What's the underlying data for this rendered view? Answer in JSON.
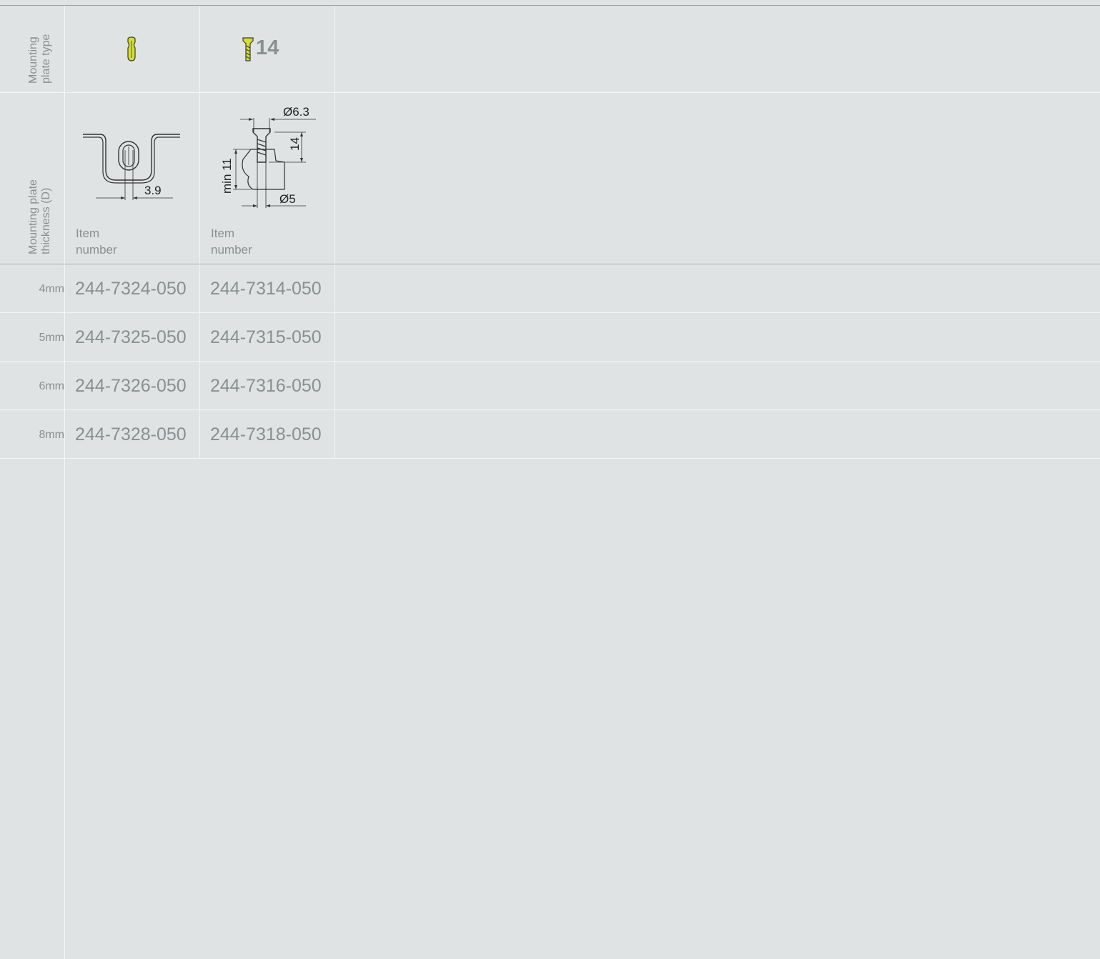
{
  "header": {
    "type_label_line1": "Mounting",
    "type_label_line2": "plate type",
    "thickness_label_line1": "Mounting plate",
    "thickness_label_line2": "thickness (D)"
  },
  "columns": [
    {
      "icon": "snap-in-dowel-icon",
      "icon_color": "#d4e02a",
      "item_label_line1": "Item",
      "item_label_line2": "number",
      "dimension": "3.9"
    },
    {
      "icon": "screw-icon",
      "icon_color": "#d4e02a",
      "type_text": "14",
      "item_label_line1": "Item",
      "item_label_line2": "number",
      "dim_head_diameter": "Ø6.3",
      "dim_length": "14",
      "dim_min": "min 11",
      "dim_shaft_diameter": "Ø5"
    }
  ],
  "rows": [
    {
      "thickness": "4mm",
      "items": [
        "244-7324-050",
        "244-7314-050"
      ]
    },
    {
      "thickness": "5mm",
      "items": [
        "244-7325-050",
        "244-7315-050"
      ]
    },
    {
      "thickness": "6mm",
      "items": [
        "244-7326-050",
        "244-7316-050"
      ]
    },
    {
      "thickness": "8mm",
      "items": [
        "244-7328-050",
        "244-7318-050"
      ]
    }
  ]
}
